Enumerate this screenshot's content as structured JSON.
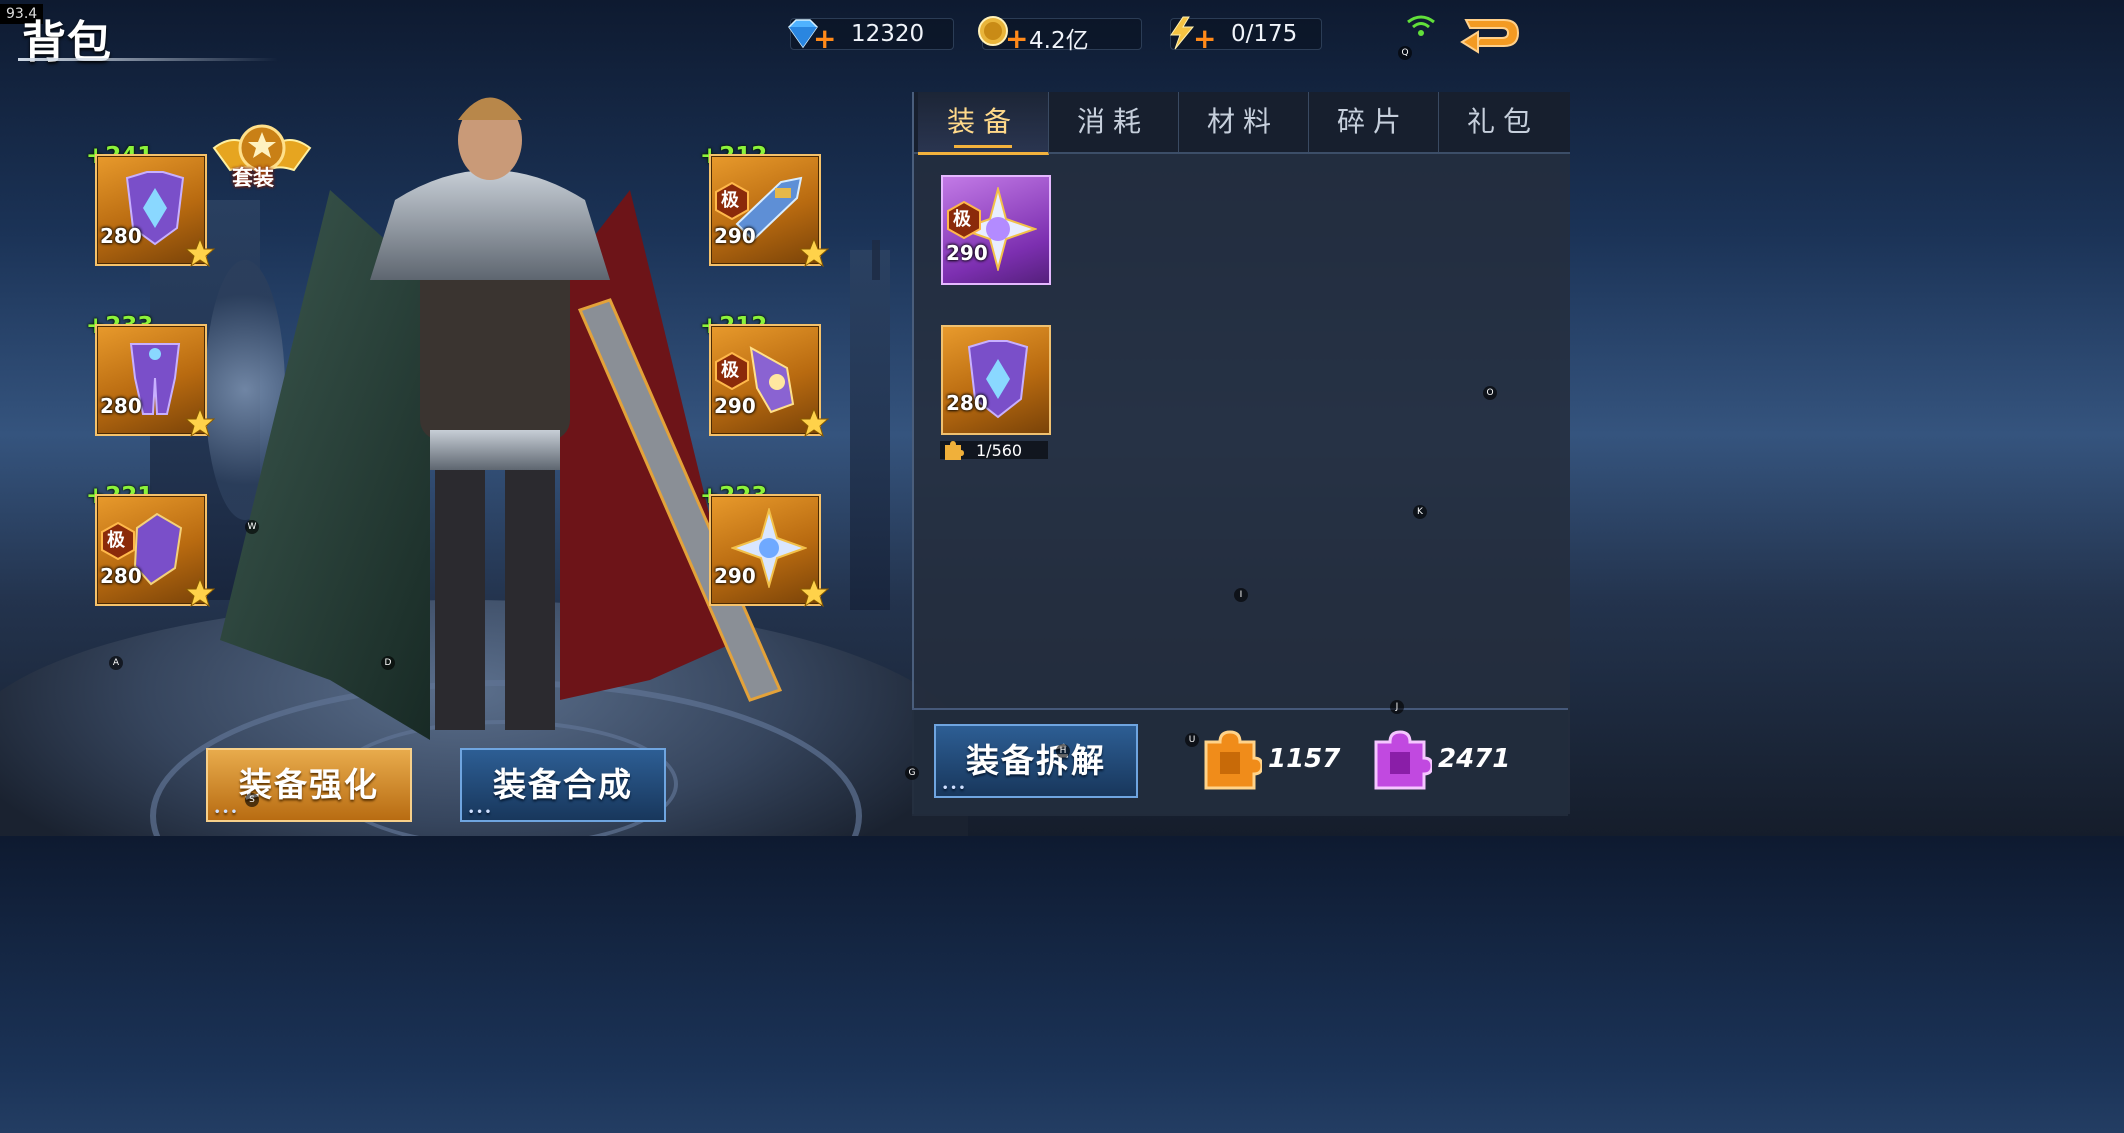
{
  "hud": {
    "fps": "93.4",
    "title": "背包",
    "diamonds": "12320",
    "gold": "4.2亿",
    "energy": "0/175"
  },
  "equipped": {
    "left": [
      {
        "bonus": "+241",
        "level": "280",
        "ji": false
      },
      {
        "bonus": "+233",
        "level": "280",
        "ji": false
      },
      {
        "bonus": "+221",
        "level": "280",
        "ji": true,
        "ji_label": "极"
      }
    ],
    "right": [
      {
        "bonus": "+212",
        "level": "290",
        "ji": true,
        "ji_label": "极"
      },
      {
        "bonus": "+212",
        "level": "290",
        "ji": true,
        "ji_label": "极"
      },
      {
        "bonus": "+223",
        "level": "290",
        "ji": false
      }
    ],
    "suit_label": "套装"
  },
  "tabs": [
    "装备",
    "消耗",
    "材料",
    "碎片",
    "礼包"
  ],
  "active_tab": 0,
  "bag": {
    "items": [
      {
        "level": "290",
        "rarity": "purple",
        "ji_label": "极"
      },
      {
        "level": "280",
        "rarity": "orange",
        "fragment": "1/560"
      }
    ]
  },
  "buttons": {
    "enhance": "装备强化",
    "compose": "装备合成",
    "dismantle": "装备拆解"
  },
  "currencies": {
    "orange_shards": "1157",
    "purple_shards": "2471"
  },
  "markers": [
    "Q",
    "O",
    "K",
    "I",
    "J",
    "U",
    "G",
    "A",
    "D",
    "W",
    "S",
    "H"
  ],
  "colors": {
    "bonus_green": "#8cf33a",
    "accent_gold": "#f3b23d",
    "tab_active": "#ffd98a"
  }
}
